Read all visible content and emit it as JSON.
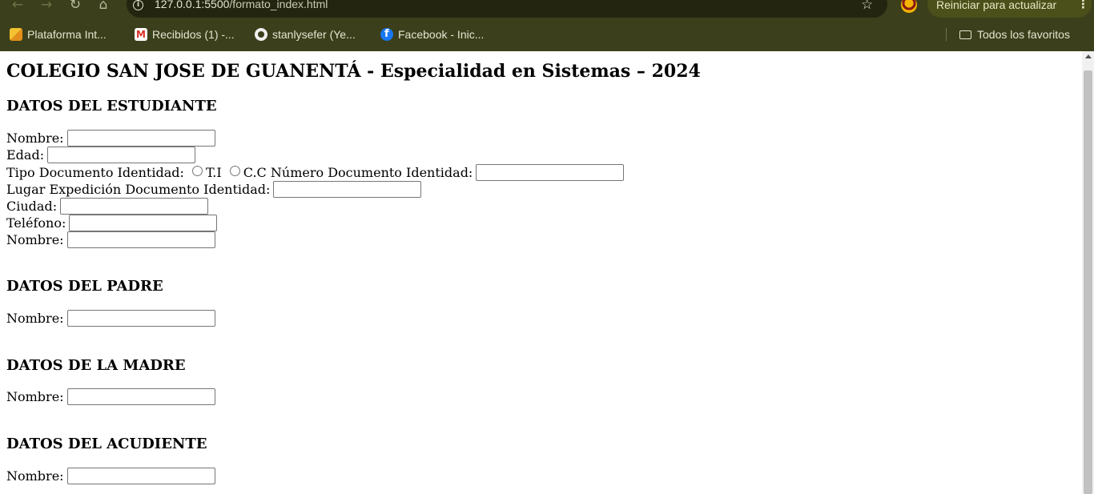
{
  "browser": {
    "url_host": "127.0.0.1:5500",
    "url_path": "/formato_index.html",
    "update_label": "Reiniciar para actualizar",
    "bookmarks": [
      {
        "label": "Plataforma Int...",
        "icon": "puzzle-icon"
      },
      {
        "label": "Recibidos (1) -...",
        "icon": "gmail-icon"
      },
      {
        "label": "stanlysefer (Ye...",
        "icon": "github-icon"
      },
      {
        "label": "Facebook - Inic...",
        "icon": "facebook-icon"
      }
    ],
    "all_bookmarks_label": "Todos los favoritos",
    "colors": {
      "chrome": "#3c3f1b",
      "omnibox": "#232510",
      "update_pill": "#4b4f19"
    }
  },
  "page": {
    "title": "COLEGIO SAN JOSE DE GUANENTÁ - Especialidad en Sistemas – 2024",
    "student": {
      "heading": "DATOS DEL ESTUDIANTE",
      "name_label": "Nombre:",
      "age_label": "Edad:",
      "doc_type_label": "Tipo Documento Identidad:",
      "doc_option_ti": "T.I",
      "doc_option_cc": "C.C",
      "doc_number_label": "Número Documento Identidad:",
      "doc_place_label": "Lugar Expedición Documento Identidad:",
      "city_label": "Ciudad:",
      "phone_label": "Teléfono:",
      "name2_label": "Nombre:"
    },
    "father": {
      "heading": "DATOS DEL PADRE",
      "name_label": "Nombre:"
    },
    "mother": {
      "heading": "DATOS DE LA MADRE",
      "name_label": "Nombre:"
    },
    "guardian": {
      "heading": "DATOS DEL ACUDIENTE",
      "name_label": "Nombre:"
    }
  }
}
